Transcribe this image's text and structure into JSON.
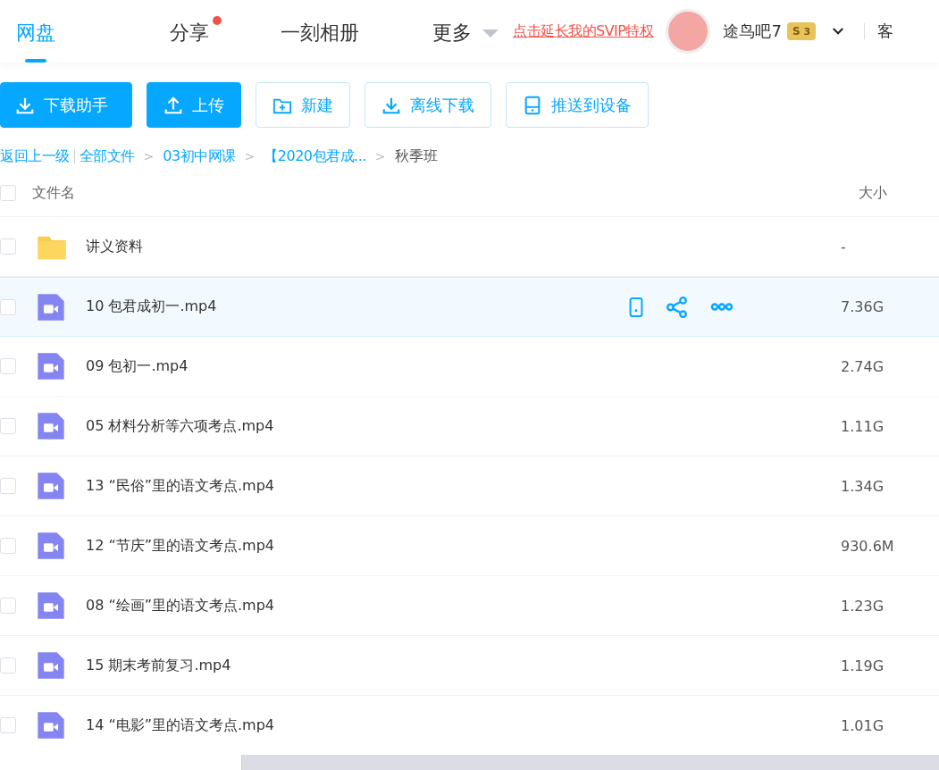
{
  "nav": {
    "tabs": [
      {
        "label": "网盘",
        "selected": true,
        "dot": false
      },
      {
        "label": "分享",
        "selected": false,
        "dot": true
      },
      {
        "label": "一刻相册",
        "selected": false,
        "dot": false
      },
      {
        "label": "更多",
        "selected": false,
        "dot": false,
        "dropdown": true
      }
    ],
    "promo": "点击延长我的SVIP特权",
    "user": {
      "name": "途鸟吧7",
      "badge_letter": "S",
      "badge_level": "3"
    },
    "cut_item": "客"
  },
  "toolbar": [
    {
      "label": "下载助手",
      "kind": "primary"
    },
    {
      "label": "上传",
      "kind": "primary"
    },
    {
      "label": "新建",
      "kind": "plain"
    },
    {
      "label": "离线下载",
      "kind": "plain"
    },
    {
      "label": "推送到设备",
      "kind": "plain"
    }
  ],
  "breadcrumb": {
    "back": "返回上一级",
    "links": [
      "全部文件",
      "03初中网课",
      "【2020包君成..."
    ],
    "separators": [
      ">",
      ">",
      ">"
    ],
    "current": "秋季班"
  },
  "table": {
    "columns": [
      "文件名",
      "大小"
    ],
    "select_all_checked": false,
    "rows": [
      {
        "name": "讲义资料",
        "size": "-",
        "kind": "folder",
        "hovered": false,
        "checked": false
      },
      {
        "name": "10 包君成初一.mp4",
        "size": "7.36G",
        "kind": "video",
        "hovered": true,
        "checked": false
      },
      {
        "name": "09 包初一.mp4",
        "size": "2.74G",
        "kind": "video",
        "hovered": false,
        "checked": false
      },
      {
        "name": "05 材料分析等六项考点.mp4",
        "size": "1.11G",
        "kind": "video",
        "hovered": false,
        "checked": false
      },
      {
        "name": "13 “民俗”里的语文考点.mp4",
        "size": "1.34G",
        "kind": "video",
        "hovered": false,
        "checked": false
      },
      {
        "name": "12 “节庆”里的语文考点.mp4",
        "size": "930.6M",
        "kind": "video",
        "hovered": false,
        "checked": false
      },
      {
        "name": "08 “绘画”里的语文考点.mp4",
        "size": "1.23G",
        "kind": "video",
        "hovered": false,
        "checked": false
      },
      {
        "name": "15 期末考前复习.mp4",
        "size": "1.19G",
        "kind": "video",
        "hovered": false,
        "checked": false
      },
      {
        "name": "14 “电影”里的语文考点.mp4",
        "size": "1.01G",
        "kind": "video",
        "hovered": false,
        "checked": false
      }
    ]
  }
}
